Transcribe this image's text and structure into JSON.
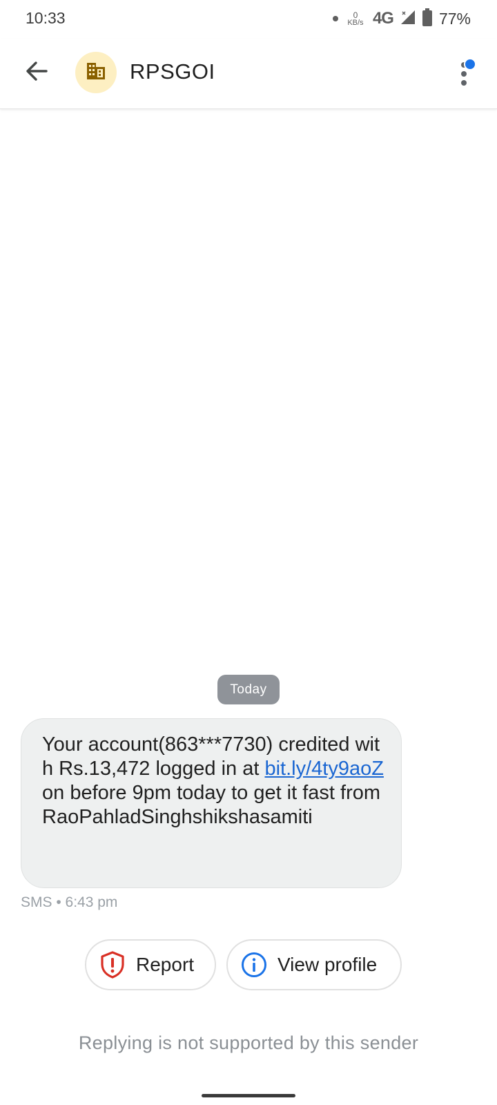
{
  "status_bar": {
    "time": "10:33",
    "speed_value": "0",
    "speed_unit": "KB/s",
    "network": "4G",
    "battery": "77%"
  },
  "header": {
    "title": "RPSGOI",
    "avatar_icon": "building-icon",
    "avatar_bg": "#fdefc2",
    "avatar_fg": "#8a6000",
    "back_icon": "arrow-back-icon",
    "menu_icon": "more-vert-icon",
    "badge_color": "#1a73e8"
  },
  "conversation": {
    "date_label": "Today",
    "message": {
      "text_before": "Your account(863***7730) credited with Rs.13,472 logged in at ",
      "link": "bit.ly/4ty9aoZ",
      "text_after": " on before 9pm today to get it fast fromRaoPahladSinghshikshasamiti",
      "meta": "SMS • 6:43 pm"
    }
  },
  "actions": {
    "report_label": "Report",
    "report_icon": "shield-alert-icon",
    "report_color": "#d93025",
    "view_profile_label": "View profile",
    "view_profile_icon": "info-icon",
    "view_profile_color": "#1a73e8"
  },
  "footer": {
    "reply_note": "Replying is not supported by this sender"
  }
}
